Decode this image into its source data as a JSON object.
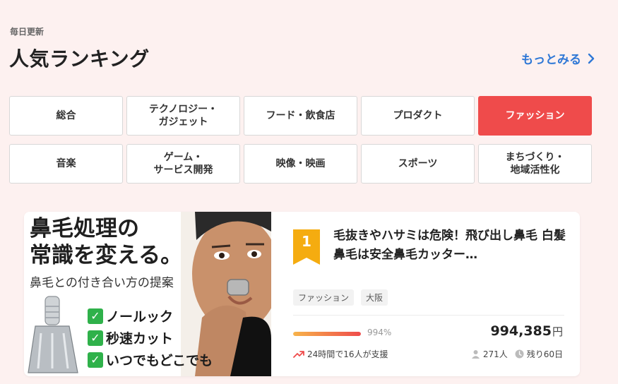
{
  "header": {
    "eyebrow": "毎日更新",
    "title": "人気ランキング",
    "more_label": "もっとみる"
  },
  "categories": [
    {
      "label": "総合",
      "active": false
    },
    {
      "label": "テクノロジー・\nガジェット",
      "active": false
    },
    {
      "label": "フード・飲食店",
      "active": false
    },
    {
      "label": "プロダクト",
      "active": false
    },
    {
      "label": "ファッション",
      "active": true
    },
    {
      "label": "音楽",
      "active": false
    },
    {
      "label": "ゲーム・\nサービス開発",
      "active": false
    },
    {
      "label": "映像・映画",
      "active": false
    },
    {
      "label": "スポーツ",
      "active": false
    },
    {
      "label": "まちづくり・\n地域活性化",
      "active": false
    }
  ],
  "ranking_item": {
    "rank": "1",
    "thumbnail": {
      "title": "鼻毛処理の\n常識を変える。",
      "subtitle": "鼻毛との付き合い方の提案",
      "points": [
        "ノールック",
        "秒速カット",
        "いつでもどこでも"
      ]
    },
    "title": "毛抜きやハサミは危険！飛び出し鼻毛 白髪鼻毛は安全鼻毛カッター…",
    "tags": [
      "ファッション",
      "大阪"
    ],
    "progress_percent": "994%",
    "progress_fraction": 1.0,
    "amount": "994,385",
    "currency": "円",
    "trend_text": "24時間で16人が支援",
    "supporters": "271人",
    "remaining": "残り60日"
  },
  "colors": {
    "background": "#fdf1f0",
    "accent_red": "#ef4b4b",
    "link_blue": "#2f78d6",
    "rank_badge": "#f5ac10"
  }
}
